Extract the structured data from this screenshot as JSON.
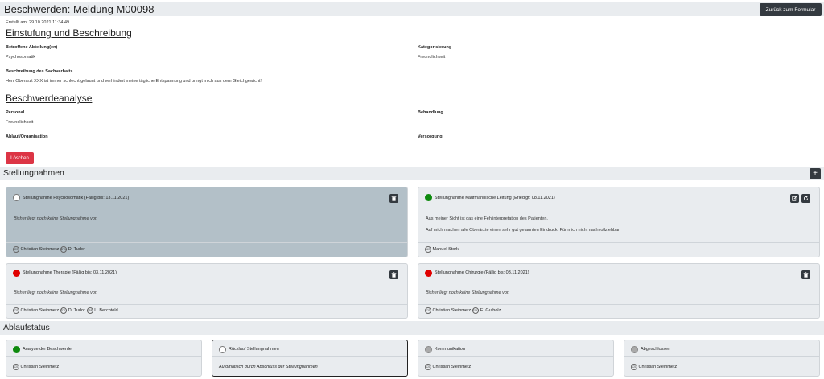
{
  "header": {
    "title": "Beschwerden: Meldung M00098",
    "back_button": "Zurück zum Formular"
  },
  "created": "Erstellt am: 29.10.2021 11:34:49",
  "einstufung": {
    "title": "Einstufung und Beschreibung",
    "abteilung_label": "Betroffene Abteilung(en)",
    "abteilung_value": "Psychosomatik",
    "kategorisierung_label": "Kategorisierung",
    "kategorisierung_value": "Freundlichkeit",
    "beschreibung_label": "Beschreibung des Sachverhalts",
    "beschreibung_value": "Herr Oberarzt XXX ist immer schlecht gelaunt und verhindert meine tägliche Entspannung und bringt mich aus dem Gleichgewicht!"
  },
  "analyse": {
    "title": "Beschwerdeanalyse",
    "personal_label": "Personal",
    "personal_value": "Freundlichkeit",
    "behandlung_label": "Behandlung",
    "ablauf_label": "Ablauf/Organisation",
    "versorgung_label": "Versorgung"
  },
  "delete_button": "Löschen",
  "stellungnahmen": {
    "title": "Stellungnahmen",
    "add_button": "+",
    "cards": [
      {
        "title": "Stellungnahme Psychosomatik (Fällig bis: 13.11.2021)",
        "status": "open",
        "body": [
          "Bisher liegt noch keine Stellungnahme vor."
        ],
        "people": [
          {
            "initials": "CS",
            "name": "Christian Steinmetz"
          },
          {
            "initials": "DTU",
            "name": "D. Tudor"
          }
        ]
      },
      {
        "title": "Stellungnahme Kaufmännische Leitung (Erledigt: 08.11.2021)",
        "status": "done",
        "body": [
          "Aus meiner Sicht ist das eine Fehlinterpretation des Patienten.",
          "Auf mich machen alle Oberärzte einen sehr gut gelaunten Eindruck. Für mich nicht nachvollziehbar."
        ],
        "people": [
          {
            "initials": "MS",
            "name": "Manuel Stork"
          }
        ]
      },
      {
        "title": "Stellungnahme Therapie (Fällig bis: 03.11.2021)",
        "status": "overdue",
        "body": [
          "Bisher liegt noch keine Stellungnahme vor."
        ],
        "people": [
          {
            "initials": "CS",
            "name": "Christian Steinmetz"
          },
          {
            "initials": "DTU",
            "name": "D. Tudor"
          },
          {
            "initials": "LBE",
            "name": "L. Berchtold"
          }
        ]
      },
      {
        "title": "Stellungnahme Chirurgie (Fällig bis: 03.11.2021)",
        "status": "overdue",
        "body": [
          "Bisher liegt noch keine Stellungnahme vor."
        ],
        "people": [
          {
            "initials": "CS",
            "name": "Christian Steinmetz"
          },
          {
            "initials": "EGU",
            "name": "E. Gutholz"
          }
        ]
      }
    ]
  },
  "ablaufstatus": {
    "title": "Ablaufstatus",
    "steps": [
      {
        "title": "Analyse der Beschwerde",
        "status": "done",
        "person_initials": "CS",
        "person": "Christian Steinmetz"
      },
      {
        "title": "Rücklauf Stellungnahmen",
        "status": "current",
        "note": "Automatisch durch Abschluss der Stellungnahmen"
      },
      {
        "title": "Kommunikation",
        "status": "pending",
        "person_initials": "CS",
        "person": "Christian Steinmetz"
      },
      {
        "title": "Abgeschlossen",
        "status": "pending",
        "person_initials": "CS",
        "person": "Christian Steinmetz"
      }
    ]
  },
  "colors": {
    "dark_button": "#343a40",
    "danger": "#dc3545",
    "done": "#0e8a0e",
    "overdue": "#e00000",
    "active_card": "#b3c0c8"
  },
  "icons": {
    "delete": "trash-icon",
    "edit": "edit-icon",
    "reload": "reload-icon",
    "add": "plus-icon"
  }
}
